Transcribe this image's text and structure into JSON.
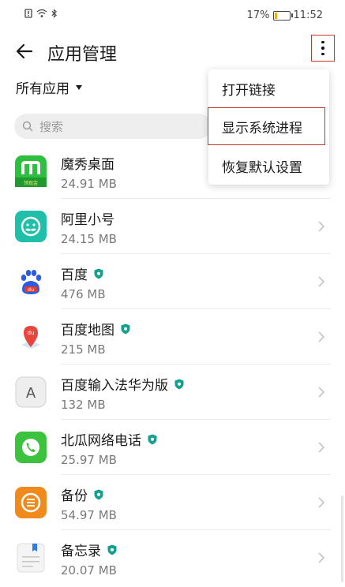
{
  "status": {
    "battery_percent": "17%",
    "time": "11:52",
    "battery_level": 0.17
  },
  "header": {
    "title": "应用管理"
  },
  "filter": {
    "label": "所有应用"
  },
  "search": {
    "placeholder": "搜索"
  },
  "menu": {
    "items": [
      {
        "label": "打开链接"
      },
      {
        "label": "显示系统进程"
      },
      {
        "label": "恢复默认设置"
      }
    ]
  },
  "apps": [
    {
      "name": "魔秀桌面",
      "size": "24.91 MB",
      "icon": "moxiu-icon",
      "badge": false
    },
    {
      "name": "阿里小号",
      "size": "24.15 MB",
      "icon": "alixiaohao-icon",
      "badge": false
    },
    {
      "name": "百度",
      "size": "476 MB",
      "icon": "baidu-icon",
      "badge": true
    },
    {
      "name": "百度地图",
      "size": "215 MB",
      "icon": "baidu-map-icon",
      "badge": true
    },
    {
      "name": "百度输入法华为版",
      "size": "132 MB",
      "icon": "baidu-input-icon",
      "badge": true
    },
    {
      "name": "北瓜网络电话",
      "size": "25.97 MB",
      "icon": "beigua-phone-icon",
      "badge": true
    },
    {
      "name": "备份",
      "size": "54.97 MB",
      "icon": "backup-icon",
      "badge": true
    },
    {
      "name": "备忘录",
      "size": "20.07 MB",
      "icon": "memo-icon",
      "badge": true
    }
  ],
  "icon_badge_text": "领现金"
}
